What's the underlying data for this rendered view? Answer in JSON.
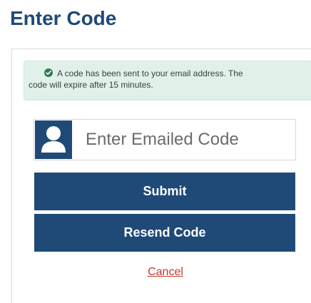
{
  "page": {
    "title": "Enter Code"
  },
  "alert": {
    "icon": "check-circle-icon",
    "message_line1": "A code has been sent to your email address. The",
    "message_line2": "code will expire after 15 minutes.",
    "background_color": "#e1f1ea",
    "icon_color": "#2e7d4f"
  },
  "code_field": {
    "icon": "user-icon",
    "placeholder": "Enter Emailed Code",
    "value": ""
  },
  "buttons": {
    "submit_label": "Submit",
    "resend_label": "Resend Code",
    "color": "#1f4a78"
  },
  "cancel": {
    "label": "Cancel",
    "color": "#c0392b"
  }
}
